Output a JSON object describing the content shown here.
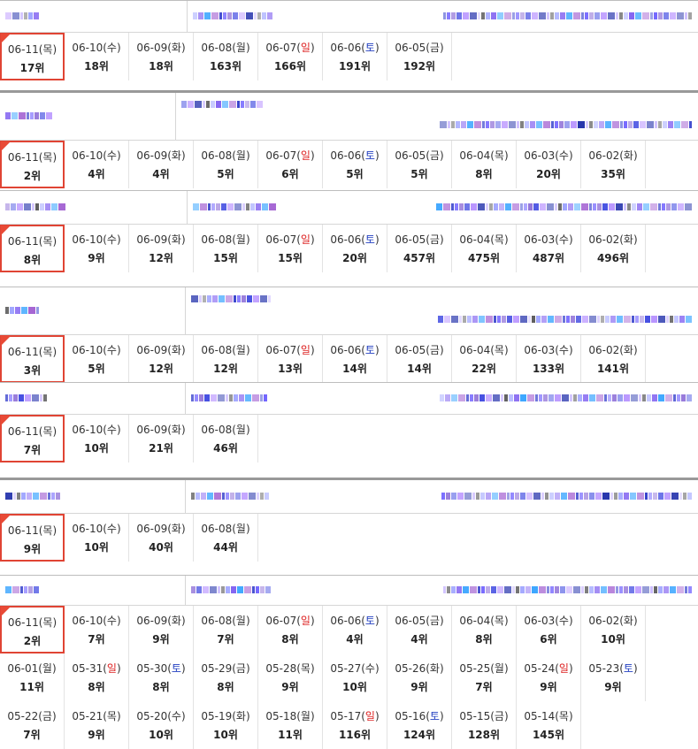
{
  "blocks": [
    {
      "ranks": [
        {
          "date": "06-11",
          "day": "목",
          "rank": "17위",
          "dtype": "wk",
          "today": true
        },
        {
          "date": "06-10",
          "day": "수",
          "rank": "18위",
          "dtype": "wk"
        },
        {
          "date": "06-09",
          "day": "화",
          "rank": "18위",
          "dtype": "wk"
        },
        {
          "date": "06-08",
          "day": "월",
          "rank": "163위",
          "dtype": "wk"
        },
        {
          "date": "06-07",
          "day": "일",
          "rank": "166위",
          "dtype": "sun"
        },
        {
          "date": "06-06",
          "day": "토",
          "rank": "191위",
          "dtype": "sat"
        },
        {
          "date": "06-05",
          "day": "금",
          "rank": "192위",
          "dtype": "wk"
        }
      ]
    },
    {
      "ranks": [
        {
          "date": "06-11",
          "day": "목",
          "rank": "2위",
          "dtype": "wk",
          "today": true
        },
        {
          "date": "06-10",
          "day": "수",
          "rank": "4위",
          "dtype": "wk"
        },
        {
          "date": "06-09",
          "day": "화",
          "rank": "4위",
          "dtype": "wk"
        },
        {
          "date": "06-08",
          "day": "월",
          "rank": "5위",
          "dtype": "wk"
        },
        {
          "date": "06-07",
          "day": "일",
          "rank": "6위",
          "dtype": "sun"
        },
        {
          "date": "06-06",
          "day": "토",
          "rank": "5위",
          "dtype": "sat"
        },
        {
          "date": "06-05",
          "day": "금",
          "rank": "5위",
          "dtype": "wk"
        },
        {
          "date": "06-04",
          "day": "목",
          "rank": "8위",
          "dtype": "wk"
        },
        {
          "date": "06-03",
          "day": "수",
          "rank": "20위",
          "dtype": "wk"
        },
        {
          "date": "06-02",
          "day": "화",
          "rank": "35위",
          "dtype": "wk"
        }
      ]
    },
    {
      "ranks": [
        {
          "date": "06-11",
          "day": "목",
          "rank": "8위",
          "dtype": "wk",
          "today": true
        },
        {
          "date": "06-10",
          "day": "수",
          "rank": "9위",
          "dtype": "wk"
        },
        {
          "date": "06-09",
          "day": "화",
          "rank": "12위",
          "dtype": "wk"
        },
        {
          "date": "06-08",
          "day": "월",
          "rank": "15위",
          "dtype": "wk"
        },
        {
          "date": "06-07",
          "day": "일",
          "rank": "15위",
          "dtype": "sun"
        },
        {
          "date": "06-06",
          "day": "토",
          "rank": "20위",
          "dtype": "sat"
        },
        {
          "date": "06-05",
          "day": "금",
          "rank": "457위",
          "dtype": "wk"
        },
        {
          "date": "06-04",
          "day": "목",
          "rank": "475위",
          "dtype": "wk"
        },
        {
          "date": "06-03",
          "day": "수",
          "rank": "487위",
          "dtype": "wk"
        },
        {
          "date": "06-02",
          "day": "화",
          "rank": "496위",
          "dtype": "wk"
        }
      ]
    },
    {
      "ranks": [
        {
          "date": "06-11",
          "day": "목",
          "rank": "3위",
          "dtype": "wk",
          "today": true
        },
        {
          "date": "06-10",
          "day": "수",
          "rank": "5위",
          "dtype": "wk"
        },
        {
          "date": "06-09",
          "day": "화",
          "rank": "12위",
          "dtype": "wk"
        },
        {
          "date": "06-08",
          "day": "월",
          "rank": "12위",
          "dtype": "wk"
        },
        {
          "date": "06-07",
          "day": "일",
          "rank": "13위",
          "dtype": "sun"
        },
        {
          "date": "06-06",
          "day": "토",
          "rank": "14위",
          "dtype": "sat"
        },
        {
          "date": "06-05",
          "day": "금",
          "rank": "14위",
          "dtype": "wk"
        },
        {
          "date": "06-04",
          "day": "목",
          "rank": "22위",
          "dtype": "wk"
        },
        {
          "date": "06-03",
          "day": "수",
          "rank": "133위",
          "dtype": "wk"
        },
        {
          "date": "06-02",
          "day": "화",
          "rank": "141위",
          "dtype": "wk"
        }
      ]
    },
    {
      "ranks": [
        {
          "date": "06-11",
          "day": "목",
          "rank": "7위",
          "dtype": "wk",
          "today": true
        },
        {
          "date": "06-10",
          "day": "수",
          "rank": "10위",
          "dtype": "wk"
        },
        {
          "date": "06-09",
          "day": "화",
          "rank": "21위",
          "dtype": "wk"
        },
        {
          "date": "06-08",
          "day": "월",
          "rank": "46위",
          "dtype": "wk"
        }
      ]
    },
    {
      "ranks": [
        {
          "date": "06-11",
          "day": "목",
          "rank": "9위",
          "dtype": "wk",
          "today": true
        },
        {
          "date": "06-10",
          "day": "수",
          "rank": "10위",
          "dtype": "wk"
        },
        {
          "date": "06-09",
          "day": "화",
          "rank": "40위",
          "dtype": "wk"
        },
        {
          "date": "06-08",
          "day": "월",
          "rank": "44위",
          "dtype": "wk"
        }
      ]
    },
    {
      "ranks": [
        {
          "date": "06-11",
          "day": "목",
          "rank": "2위",
          "dtype": "wk",
          "today": true
        },
        {
          "date": "06-10",
          "day": "수",
          "rank": "7위",
          "dtype": "wk"
        },
        {
          "date": "06-09",
          "day": "화",
          "rank": "9위",
          "dtype": "wk"
        },
        {
          "date": "06-08",
          "day": "월",
          "rank": "7위",
          "dtype": "wk"
        },
        {
          "date": "06-07",
          "day": "일",
          "rank": "8위",
          "dtype": "sun"
        },
        {
          "date": "06-06",
          "day": "토",
          "rank": "4위",
          "dtype": "sat"
        },
        {
          "date": "06-05",
          "day": "금",
          "rank": "4위",
          "dtype": "wk"
        },
        {
          "date": "06-04",
          "day": "목",
          "rank": "8위",
          "dtype": "wk"
        },
        {
          "date": "06-03",
          "day": "수",
          "rank": "6위",
          "dtype": "wk"
        },
        {
          "date": "06-02",
          "day": "화",
          "rank": "10위",
          "dtype": "wk"
        },
        {
          "date": "06-01",
          "day": "월",
          "rank": "11위",
          "dtype": "wk"
        },
        {
          "date": "05-31",
          "day": "일",
          "rank": "8위",
          "dtype": "sun"
        },
        {
          "date": "05-30",
          "day": "토",
          "rank": "8위",
          "dtype": "sat"
        },
        {
          "date": "05-29",
          "day": "금",
          "rank": "8위",
          "dtype": "wk"
        },
        {
          "date": "05-28",
          "day": "목",
          "rank": "9위",
          "dtype": "wk"
        },
        {
          "date": "05-27",
          "day": "수",
          "rank": "10위",
          "dtype": "wk"
        },
        {
          "date": "05-26",
          "day": "화",
          "rank": "9위",
          "dtype": "wk"
        },
        {
          "date": "05-25",
          "day": "월",
          "rank": "7위",
          "dtype": "wk"
        },
        {
          "date": "05-24",
          "day": "일",
          "rank": "9위",
          "dtype": "sun"
        },
        {
          "date": "05-23",
          "day": "토",
          "rank": "9위",
          "dtype": "sat"
        },
        {
          "date": "05-22",
          "day": "금",
          "rank": "7위",
          "dtype": "wk"
        },
        {
          "date": "05-21",
          "day": "목",
          "rank": "9위",
          "dtype": "wk"
        },
        {
          "date": "05-20",
          "day": "수",
          "rank": "10위",
          "dtype": "wk"
        },
        {
          "date": "05-19",
          "day": "화",
          "rank": "10위",
          "dtype": "wk"
        },
        {
          "date": "05-18",
          "day": "월",
          "rank": "11위",
          "dtype": "wk"
        },
        {
          "date": "05-17",
          "day": "일",
          "rank": "116위",
          "dtype": "sun"
        },
        {
          "date": "05-16",
          "day": "토",
          "rank": "124위",
          "dtype": "sat"
        },
        {
          "date": "05-15",
          "day": "금",
          "rank": "128위",
          "dtype": "wk"
        },
        {
          "date": "05-14",
          "day": "목",
          "rank": "145위",
          "dtype": "wk"
        }
      ]
    }
  ],
  "colors": {
    "today_border": "#e04434",
    "sunday": "#d22222",
    "saturday": "#2340c0"
  }
}
